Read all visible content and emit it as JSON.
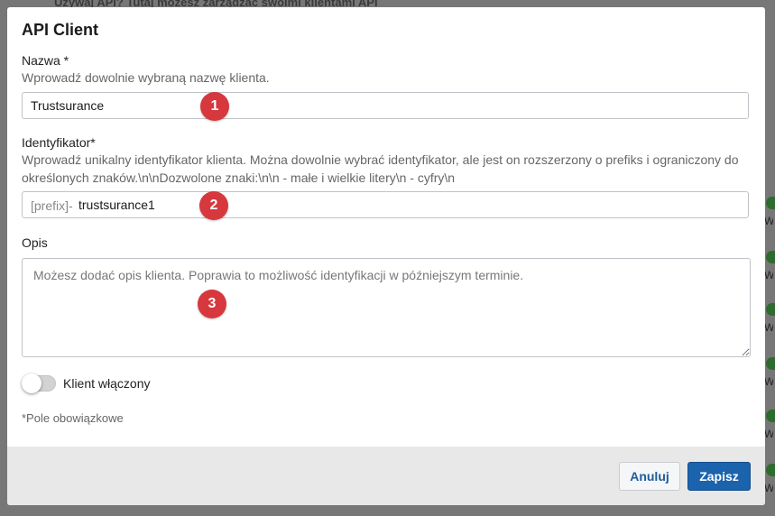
{
  "background": {
    "header_text": "Używaj API? Tutaj możesz zarządzać swoimi klientami API",
    "side_label": "Wł"
  },
  "modal": {
    "title": "API Client",
    "name": {
      "label": "Nazwa *",
      "help": "Wprowadź dowolnie wybraną nazwę klienta.",
      "value": "Trustsurance"
    },
    "identifier": {
      "label": "Identyfikator*",
      "help": "Wprowadź unikalny identyfikator klienta. Można dowolnie wybrać identyfikator, ale jest on rozszerzony o prefiks i ograniczony do określonych znaków.\\n\\nDozwolone znaki:\\n\\n - małe i wielkie litery\\n - cyfry\\n",
      "prefix": "[prefix]-",
      "value": "trustsurance1"
    },
    "description": {
      "label": "Opis",
      "placeholder": "Możesz dodać opis klienta. Poprawia to możliwość identyfikacji w późniejszym terminie."
    },
    "toggle": {
      "label": "Klient włączony",
      "enabled": false
    },
    "required_note": "*Pole obowiązkowe",
    "buttons": {
      "cancel": "Anuluj",
      "save": "Zapisz"
    }
  },
  "badges": [
    "1",
    "2",
    "3"
  ],
  "colors": {
    "badge": "#d6383e",
    "primary": "#1b63ad",
    "footer": "#e8e8e8"
  }
}
